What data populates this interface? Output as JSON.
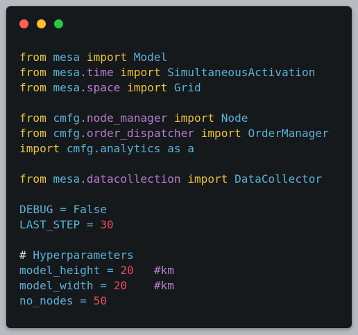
{
  "window_controls": {
    "close_color": "#ff5f57",
    "minimize_color": "#febc2e",
    "maximize_color": "#28c840"
  },
  "code_lines": [
    [
      {
        "t": "kw",
        "v": "from"
      },
      {
        "t": "plain",
        "v": " mesa "
      },
      {
        "t": "kw",
        "v": "import"
      },
      {
        "t": "name",
        "v": " Model"
      }
    ],
    [
      {
        "t": "kw",
        "v": "from"
      },
      {
        "t": "plain",
        "v": " mesa"
      },
      {
        "t": "dot",
        "v": "."
      },
      {
        "t": "attr",
        "v": "time"
      },
      {
        "t": "plain",
        "v": " "
      },
      {
        "t": "kw",
        "v": "import"
      },
      {
        "t": "name",
        "v": " SimultaneousActivation"
      }
    ],
    [
      {
        "t": "kw",
        "v": "from"
      },
      {
        "t": "plain",
        "v": " mesa"
      },
      {
        "t": "dot",
        "v": "."
      },
      {
        "t": "attr",
        "v": "space"
      },
      {
        "t": "plain",
        "v": " "
      },
      {
        "t": "kw",
        "v": "import"
      },
      {
        "t": "name",
        "v": " Grid"
      }
    ],
    [],
    [
      {
        "t": "kw",
        "v": "from"
      },
      {
        "t": "plain",
        "v": " cmfg"
      },
      {
        "t": "dot",
        "v": "."
      },
      {
        "t": "attr",
        "v": "node_manager"
      },
      {
        "t": "plain",
        "v": " "
      },
      {
        "t": "kw",
        "v": "import"
      },
      {
        "t": "name",
        "v": " Node"
      }
    ],
    [
      {
        "t": "kw",
        "v": "from"
      },
      {
        "t": "plain",
        "v": " cmfg"
      },
      {
        "t": "dot",
        "v": "."
      },
      {
        "t": "attr",
        "v": "order_dispatcher"
      },
      {
        "t": "plain",
        "v": " "
      },
      {
        "t": "kw",
        "v": "import"
      },
      {
        "t": "name",
        "v": " OrderManager"
      }
    ],
    [
      {
        "t": "kw",
        "v": "import"
      },
      {
        "t": "plain",
        "v": " cmfg"
      },
      {
        "t": "dot",
        "v": "."
      },
      {
        "t": "plain",
        "v": "analytics as a"
      }
    ],
    [],
    [
      {
        "t": "kw",
        "v": "from"
      },
      {
        "t": "plain",
        "v": " mesa"
      },
      {
        "t": "dot",
        "v": "."
      },
      {
        "t": "attr",
        "v": "datacollection"
      },
      {
        "t": "plain",
        "v": " "
      },
      {
        "t": "kw",
        "v": "import"
      },
      {
        "t": "name",
        "v": " DataCollector"
      }
    ],
    [],
    [
      {
        "t": "plain",
        "v": "DEBUG "
      },
      {
        "t": "op",
        "v": "="
      },
      {
        "t": "plain",
        "v": " False"
      }
    ],
    [
      {
        "t": "plain",
        "v": "LAST_STEP "
      },
      {
        "t": "op",
        "v": "="
      },
      {
        "t": "plain",
        "v": " "
      },
      {
        "t": "num",
        "v": "30"
      }
    ],
    [],
    [
      {
        "t": "hash",
        "v": "#"
      },
      {
        "t": "plain",
        "v": " Hyperparameters"
      }
    ],
    [
      {
        "t": "plain",
        "v": "model_height "
      },
      {
        "t": "op",
        "v": "="
      },
      {
        "t": "plain",
        "v": " "
      },
      {
        "t": "num",
        "v": "20"
      },
      {
        "t": "plain",
        "v": "   "
      },
      {
        "t": "comment",
        "v": "#km"
      }
    ],
    [
      {
        "t": "plain",
        "v": "model_width "
      },
      {
        "t": "op",
        "v": "="
      },
      {
        "t": "plain",
        "v": " "
      },
      {
        "t": "num",
        "v": "20"
      },
      {
        "t": "plain",
        "v": "    "
      },
      {
        "t": "comment",
        "v": "#km"
      }
    ],
    [
      {
        "t": "plain",
        "v": "no_nodes "
      },
      {
        "t": "op",
        "v": "="
      },
      {
        "t": "plain",
        "v": " "
      },
      {
        "t": "num",
        "v": "50"
      }
    ]
  ]
}
